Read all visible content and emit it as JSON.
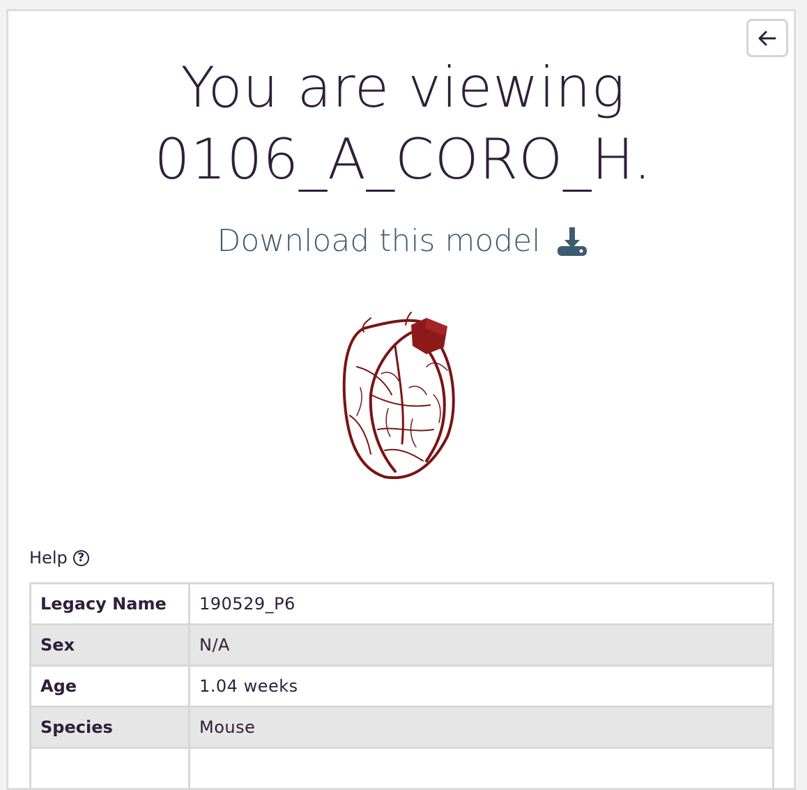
{
  "header": {
    "title_line1": "You are viewing",
    "title_line2": "0106_A_CORO_H.",
    "back_icon": "arrow-left-icon"
  },
  "download": {
    "label": "Download this model",
    "icon": "download-icon"
  },
  "model": {
    "description_icon": "heart-model"
  },
  "help": {
    "label": "Help",
    "icon": "question-circle-icon",
    "icon_glyph": "?"
  },
  "metadata": {
    "rows": [
      {
        "key": "Legacy Name",
        "value": "190529_P6"
      },
      {
        "key": "Sex",
        "value": "N/A"
      },
      {
        "key": "Age",
        "value": "1.04 weeks"
      },
      {
        "key": "Species",
        "value": "Mouse"
      },
      {
        "key": "",
        "value": ""
      }
    ]
  },
  "colors": {
    "title": "#2f1f3a",
    "download": "#3e5c70",
    "vessel": "#7a1414"
  }
}
